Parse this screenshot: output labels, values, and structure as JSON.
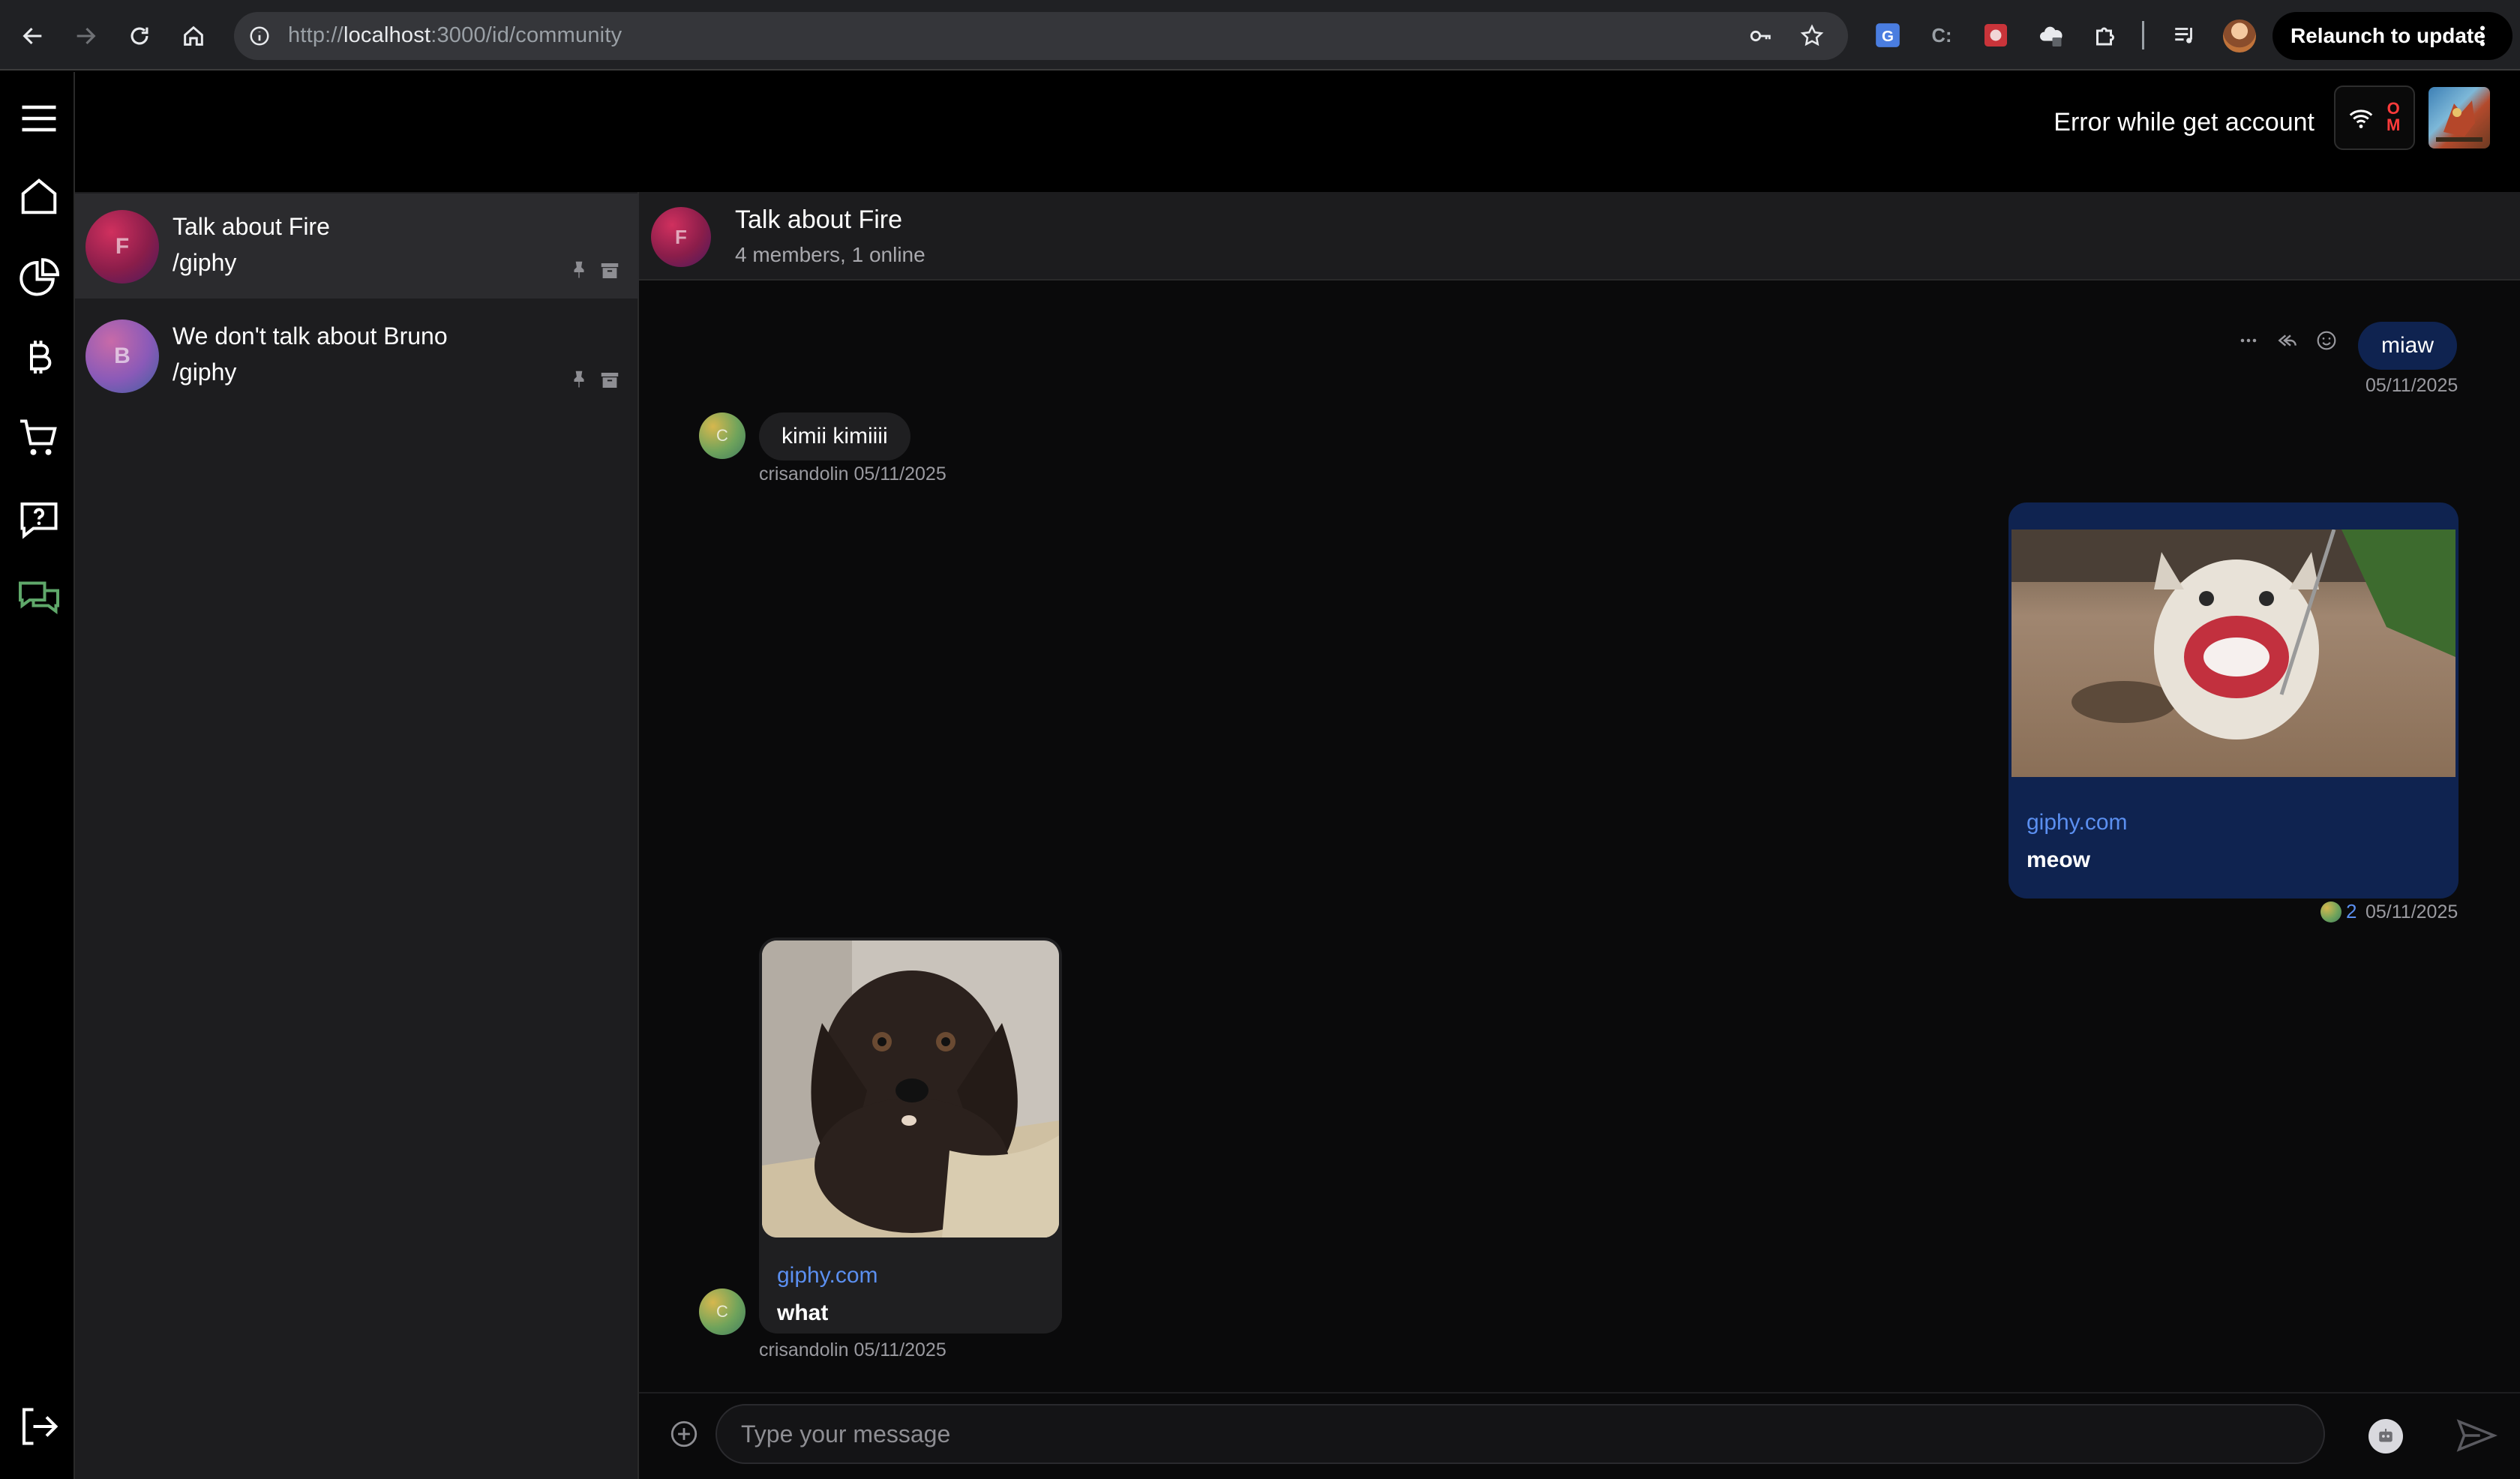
{
  "browser": {
    "url_prefix": "http://",
    "url_host": "localhost",
    "url_path": ":3000/id/community",
    "relaunch_label": "Relaunch to update"
  },
  "header": {
    "account_error": "Error while get account",
    "status_top": "O",
    "status_bottom": "M"
  },
  "channels": [
    {
      "initial": "F",
      "name": "Talk about Fire",
      "last_message": "/giphy",
      "active": true
    },
    {
      "initial": "B",
      "name": "We don't talk about Bruno",
      "last_message": "/giphy",
      "active": false
    }
  ],
  "conversation": {
    "initial": "F",
    "title": "Talk about Fire",
    "meta": "4 members, 1 online"
  },
  "messages": {
    "m1": {
      "text": "miaw",
      "timestamp": "05/11/2025"
    },
    "m2": {
      "avatar_initial": "C",
      "text": "kimii kimiiii",
      "author": "crisandolin",
      "timestamp": "05/11/2025"
    },
    "m3": {
      "link": "giphy.com",
      "caption": "meow",
      "reaction_count": "2",
      "timestamp": "05/11/2025"
    },
    "m4": {
      "avatar_initial": "C",
      "link": "giphy.com",
      "caption": "what",
      "author": "crisandolin",
      "timestamp": "05/11/2025"
    }
  },
  "composer": {
    "placeholder": "Type your message"
  },
  "colors": {
    "own_bubble": "#0f2350",
    "other_bubble": "#1f1f21",
    "link": "#5b8ff0",
    "active_nav": "#5fa86a",
    "error": "#ff3b3b"
  }
}
